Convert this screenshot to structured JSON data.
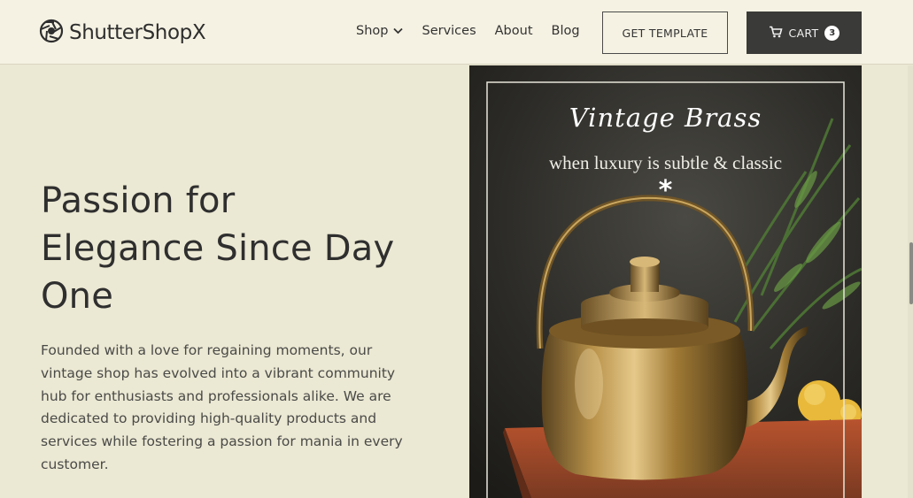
{
  "header": {
    "logo_text": "ShutterShopX",
    "nav": [
      {
        "label": "Shop",
        "has_dropdown": true
      },
      {
        "label": "Services"
      },
      {
        "label": "About"
      },
      {
        "label": "Blog"
      }
    ],
    "template_button": "GET TEMPLATE",
    "cart_label": "CART",
    "cart_count": "3"
  },
  "hero": {
    "title_line1": "Passion for",
    "title_line2": "Elegance Since Day",
    "title_line3": "One",
    "body": "Founded with a love for regaining moments, our vintage shop has evolved into a vibrant community hub for enthusiasts and professionals alike. We are dedicated to providing high-quality products and services while fostering a passion for mania in every customer."
  },
  "promo": {
    "title": "Vintage Brass",
    "subtitle": "when luxury is subtle & classic",
    "ornament": "*"
  },
  "colors": {
    "background": "#ebe8d3",
    "header": "#f5f2e3",
    "dark_button": "#3a3a38",
    "brass": "#b8924a"
  },
  "icons": [
    "aperture-logo-icon",
    "chevron-down-icon",
    "cart-icon"
  ]
}
